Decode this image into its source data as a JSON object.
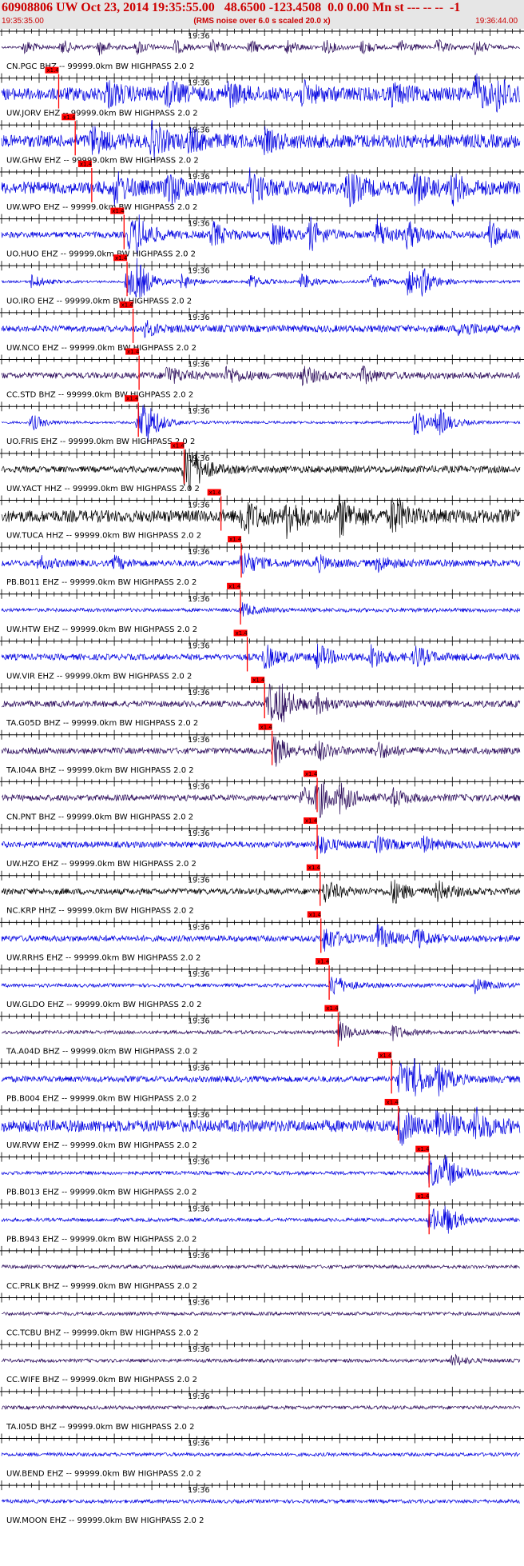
{
  "header": {
    "title": "60908806 UW Oct 23, 2014 19:35:55.00   48.6500 -123.4508  0.0 0.00 Mn st --- -- --  -1",
    "start_time": "19:35:35.00",
    "rms_note": "(RMS noise over 6.0 s scaled 20.0 x)",
    "end_time": "19:36:44.00"
  },
  "colors": {
    "blue": "#0000e0",
    "purple": "#2a0a5a",
    "black": "#000000",
    "pick": "#ff0000",
    "header_bg": "#e6e6e6",
    "header_text": "#cc0000"
  },
  "chart_data": {
    "type": "line",
    "x_unit": "seconds after 19:35:35.00",
    "xlim": [
      0,
      69
    ],
    "minute_label": "19:36",
    "minute_mark_x": 25,
    "pick_label": "x1.4",
    "traces": [
      {
        "label": "CN.PGC BHZ -- 99999.0km BW  HIGHPASS  2.0  2",
        "color": "purple",
        "pick": null,
        "amp": "spikes",
        "events": [
          [
            3,
            0.7
          ],
          [
            8,
            0.7
          ],
          [
            13,
            0.7
          ],
          [
            18,
            0.7
          ],
          [
            23,
            0.7
          ],
          [
            28,
            0.7
          ],
          [
            33,
            0.7
          ],
          [
            38,
            0.7
          ],
          [
            43,
            0.7
          ],
          [
            48,
            0.7
          ],
          [
            53,
            0.7
          ],
          [
            58,
            0.7
          ],
          [
            63,
            0.7
          ]
        ]
      },
      {
        "label": "UW.JORV EHZ -- 99999.0km BW  HIGHPASS  2.0  2",
        "color": "blue",
        "pick": 7.6,
        "amp": "high",
        "events": [
          [
            14,
            1
          ],
          [
            22,
            1
          ],
          [
            30,
            0.9
          ],
          [
            40,
            0.8
          ],
          [
            52,
            0.7
          ],
          [
            63,
            1.4
          ],
          [
            66,
            1.2
          ]
        ]
      },
      {
        "label": "UW.GHW EHZ -- 99999.0km BW  HIGHPASS  2.0  2",
        "color": "blue",
        "pick": 9.8,
        "amp": "high",
        "events": [
          [
            12,
            1
          ],
          [
            20,
            1.2
          ],
          [
            25,
            0.8
          ],
          [
            35,
            0.7
          ]
        ]
      },
      {
        "label": "UW.WPO EHZ -- 99999.0km BW  HIGHPASS  2.0  2",
        "color": "blue",
        "pick": 12.0,
        "amp": "high",
        "events": [
          [
            15,
            1.2
          ],
          [
            22,
            1.4
          ],
          [
            33,
            1.3
          ],
          [
            46,
            1.4
          ],
          [
            55,
            1.2
          ],
          [
            60,
            1
          ]
        ]
      },
      {
        "label": "UO.HUO EHZ -- 99999.0km BW  HIGHPASS  2.0  2",
        "color": "blue",
        "pick": 16.3,
        "amp": "med",
        "events": [
          [
            17,
            1.3
          ],
          [
            18,
            1.1
          ],
          [
            28,
            1.1
          ],
          [
            36,
            1.1
          ],
          [
            41,
            1.3
          ],
          [
            50,
            1.2
          ],
          [
            54,
            1.1
          ],
          [
            65,
            1.1
          ]
        ]
      },
      {
        "label": "UO.IRO EHZ -- 99999.0km BW  HIGHPASS  2.0  2",
        "color": "blue",
        "pick": 16.7,
        "amp": "spikes",
        "events": [
          [
            4,
            0.7
          ],
          [
            16.7,
            1.4
          ],
          [
            18,
            1.3
          ],
          [
            24,
            0.6
          ],
          [
            33,
            0.6
          ],
          [
            40,
            0.7
          ],
          [
            49,
            0.6
          ],
          [
            54,
            1.2
          ],
          [
            56,
            0.9
          ]
        ]
      },
      {
        "label": "UW.NCO EHZ -- 99999.0km BW  HIGHPASS  2.0  2",
        "color": "blue",
        "pick": 17.5,
        "amp": "med",
        "events": [
          [
            19,
            0.6
          ],
          [
            61,
            0.7
          ]
        ]
      },
      {
        "label": "CC.STD BHZ -- 99999.0km BW  HIGHPASS  2.0  2",
        "color": "purple",
        "pick": 18.3,
        "amp": "med",
        "events": [
          [
            22,
            0.8
          ],
          [
            30,
            0.7
          ],
          [
            40,
            0.8
          ],
          [
            48,
            0.6
          ]
        ]
      },
      {
        "label": "UO.FRIS EHZ -- 99999.0km BW  HIGHPASS  2.0  2",
        "color": "blue",
        "pick": 18.2,
        "amp": "spikes",
        "events": [
          [
            4,
            0.8
          ],
          [
            18.2,
            1.5
          ],
          [
            19,
            1.3
          ],
          [
            55,
            1.2
          ],
          [
            58,
            1.2
          ]
        ]
      },
      {
        "label": "UW.YACT HHZ -- 99999.0km BW  HIGHPASS  2.0  2",
        "color": "black",
        "pick": 24.3,
        "amp": "med",
        "events": [
          [
            24.3,
            1.6
          ],
          [
            25,
            1.2
          ]
        ]
      },
      {
        "label": "UW.TUCA HHZ -- 99999.0km BW  HIGHPASS  2.0  2",
        "color": "black",
        "pick": 29.2,
        "amp": "high",
        "events": [
          [
            32,
            1.6
          ],
          [
            38,
            1.6
          ],
          [
            45,
            1.5
          ],
          [
            52,
            1.5
          ]
        ]
      },
      {
        "label": "PB.B011 EHZ -- 99999.0km BW  HIGHPASS  2.0  2",
        "color": "blue",
        "pick": 31.9,
        "amp": "med",
        "events": [
          [
            32,
            1.1
          ],
          [
            5,
            0.6
          ],
          [
            15,
            0.6
          ],
          [
            42,
            0.6
          ],
          [
            50,
            0.6
          ]
        ]
      },
      {
        "label": "UW.HTW EHZ -- 99999.0km BW  HIGHPASS  2.0  2",
        "color": "blue",
        "pick": 31.8,
        "amp": "low",
        "events": [
          [
            32,
            0.6
          ]
        ]
      },
      {
        "label": "UW.VIR EHZ -- 99999.0km BW  HIGHPASS  2.0  2",
        "color": "blue",
        "pick": 32.7,
        "amp": "med",
        "events": [
          [
            35,
            1
          ],
          [
            42,
            1
          ],
          [
            49,
            1
          ],
          [
            55,
            0.9
          ]
        ]
      },
      {
        "label": "TA.G05D BHZ -- 99999.0km BW  HIGHPASS  2.0  2",
        "color": "purple",
        "pick": 35.0,
        "amp": "med",
        "events": [
          [
            35.5,
            1.6
          ],
          [
            37,
            1.2
          ],
          [
            42,
            0.7
          ]
        ]
      },
      {
        "label": "TA.I04A BHZ -- 99999.0km BW  HIGHPASS  2.0  2",
        "color": "purple",
        "pick": 36.0,
        "amp": "med",
        "events": [
          [
            36.3,
            1.3
          ],
          [
            42,
            0.8
          ],
          [
            50,
            0.7
          ]
        ]
      },
      {
        "label": "CN.PNT BHZ -- 99999.0km BW  HIGHPASS  2.0  2",
        "color": "purple",
        "pick": 42.0,
        "amp": "med",
        "events": [
          [
            40,
            1
          ],
          [
            42,
            1.5
          ],
          [
            45,
            1
          ],
          [
            52,
            0.7
          ]
        ]
      },
      {
        "label": "UW.HZO EHZ -- 99999.0km BW  HIGHPASS  2.0  2",
        "color": "blue",
        "pick": 42.0,
        "amp": "med",
        "events": [
          [
            42,
            0.9
          ],
          [
            50,
            0.6
          ],
          [
            56,
            0.6
          ]
        ]
      },
      {
        "label": "NC.KRP HHZ -- 99999.0km BW  HIGHPASS  2.0  2",
        "color": "black",
        "pick": 42.4,
        "amp": "med",
        "events": [
          [
            43,
            0.9
          ],
          [
            52,
            1
          ],
          [
            58,
            0.8
          ]
        ]
      },
      {
        "label": "UW.RRHS EHZ -- 99999.0km BW  HIGHPASS  2.0  2",
        "color": "blue",
        "pick": 42.5,
        "amp": "med",
        "events": [
          [
            43,
            1.1
          ],
          [
            50,
            1.1
          ],
          [
            55,
            0.8
          ]
        ]
      },
      {
        "label": "UW.GLDO EHZ -- 99999.0km BW  HIGHPASS  2.0  2",
        "color": "blue",
        "pick": 43.6,
        "amp": "low",
        "events": [
          [
            44,
            1
          ],
          [
            63,
            0.6
          ]
        ]
      },
      {
        "label": "TA.A04D BHZ -- 99999.0km BW  HIGHPASS  2.0  2",
        "color": "purple",
        "pick": 44.8,
        "amp": "low",
        "events": [
          [
            45,
            0.8
          ],
          [
            52,
            0.6
          ]
        ]
      },
      {
        "label": "PB.B004 EHZ -- 99999.0km BW  HIGHPASS  2.0  2",
        "color": "blue",
        "pick": 51.9,
        "amp": "med",
        "events": [
          [
            53,
            1.5
          ],
          [
            55,
            1.3
          ],
          [
            58,
            1.1
          ]
        ]
      },
      {
        "label": "UW.RVW EHZ -- 99999.0km BW  HIGHPASS  2.0  2",
        "color": "blue",
        "pick": 52.8,
        "amp": "high",
        "events": [
          [
            53,
            1.3
          ],
          [
            58,
            1.4
          ],
          [
            63,
            1.3
          ]
        ]
      },
      {
        "label": "PB.B013 EHZ -- 99999.0km BW  HIGHPASS  2.0  2",
        "color": "blue",
        "pick": 56.9,
        "amp": "low",
        "events": [
          [
            57,
            1.4
          ],
          [
            59,
            1.1
          ]
        ]
      },
      {
        "label": "PB.B943 EHZ -- 99999.0km BW  HIGHPASS  2.0  2",
        "color": "blue",
        "pick": 56.9,
        "amp": "low",
        "events": [
          [
            57,
            1.2
          ],
          [
            59,
            1
          ]
        ]
      },
      {
        "label": "CC.PRLK BHZ -- 99999.0km BW  HIGHPASS  2.0  2",
        "color": "purple",
        "pick": null,
        "amp": "low",
        "events": []
      },
      {
        "label": "CC.TCBU BHZ -- 99999.0km BW  HIGHPASS  2.0  2",
        "color": "purple",
        "pick": null,
        "amp": "low",
        "events": []
      },
      {
        "label": "CC.WIFE BHZ -- 99999.0km BW  HIGHPASS  2.0  2",
        "color": "purple",
        "pick": null,
        "amp": "low",
        "events": [
          [
            60,
            0.6
          ]
        ]
      },
      {
        "label": "TA.I05D BHZ -- 99999.0km BW  HIGHPASS  2.0  2",
        "color": "purple",
        "pick": null,
        "amp": "low",
        "events": []
      },
      {
        "label": "UW.BEND EHZ -- 99999.0km BW  HIGHPASS  2.0  2",
        "color": "blue",
        "pick": null,
        "amp": "low",
        "events": []
      },
      {
        "label": "UW.MOON EHZ -- 99999.0km BW  HIGHPASS  2.0  2",
        "color": "blue",
        "pick": null,
        "amp": "low",
        "events": []
      }
    ]
  }
}
